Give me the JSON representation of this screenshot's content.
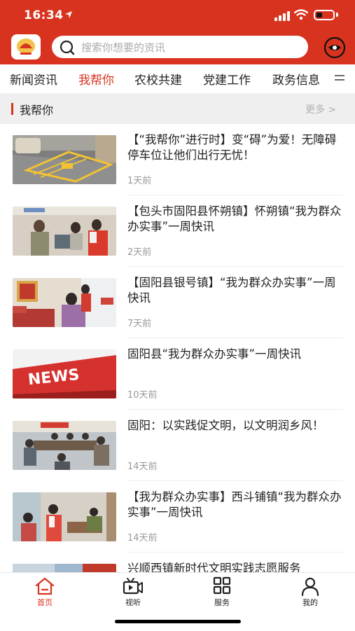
{
  "status_bar": {
    "time": "16:34"
  },
  "search": {
    "placeholder": "搜索你想要的资讯"
  },
  "tabs": [
    {
      "label": "新闻资讯"
    },
    {
      "label": "我帮你",
      "active": true
    },
    {
      "label": "农校共建"
    },
    {
      "label": "党建工作"
    },
    {
      "label": "政务信息"
    }
  ],
  "section": {
    "title": "我帮你",
    "more": "更多 >"
  },
  "news": [
    {
      "title": "【“我帮你”进行时】变“碍”为爱！无障碍停车位让他们出行无忧！",
      "time": "1天前",
      "thumb": "parking-lot-photo"
    },
    {
      "title": "【包头市固阳县怀朔镇】怀朔镇“我为群众办实事”一周快讯",
      "time": "2天前",
      "thumb": "volunteers-visit-photo"
    },
    {
      "title": "【固阳县银号镇】“我为群众办实事”一周快讯",
      "time": "7天前",
      "thumb": "haircut-service-photo"
    },
    {
      "title": "固阳县“我为群众办实事”一周快讯",
      "time": "10天前",
      "thumb": "news-sign-photo",
      "thumb_text": "NEWS"
    },
    {
      "title": "固阳：以实践促文明，以文明润乡风！",
      "time": "14天前",
      "thumb": "meeting-room-photo"
    },
    {
      "title": "【我为群众办实事】西斗铺镇“我为群众办实事”一周快讯",
      "time": "14天前",
      "thumb": "elderly-visit-photo"
    },
    {
      "title": "兴顺西镇新时代文明实践志愿服务",
      "time": "",
      "thumb": "partial-photo"
    }
  ],
  "tabbar": [
    {
      "label": "首页",
      "icon": "home-icon",
      "active": true
    },
    {
      "label": "视听",
      "icon": "video-icon"
    },
    {
      "label": "服务",
      "icon": "grid-icon"
    },
    {
      "label": "我的",
      "icon": "person-icon"
    }
  ],
  "colors": {
    "brand": "#d8331f",
    "text": "#222222",
    "muted": "#999999",
    "section_bg": "#efefef"
  }
}
